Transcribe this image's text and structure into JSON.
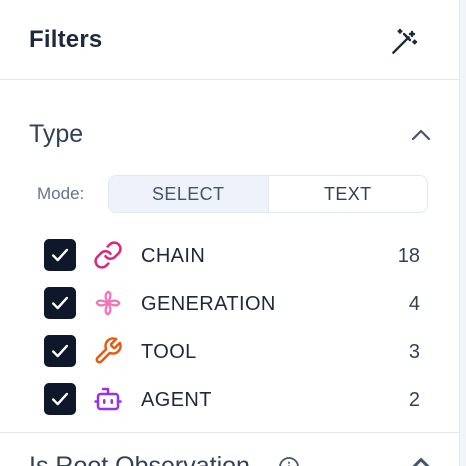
{
  "header": {
    "title": "Filters",
    "wand_icon": "magic-wand-icon"
  },
  "type_section": {
    "title": "Type",
    "collapse_icon": "chevron-up-icon",
    "mode": {
      "label": "Mode:",
      "options": [
        "SELECT",
        "TEXT"
      ],
      "selected": "SELECT"
    },
    "items": [
      {
        "label": "CHAIN",
        "count": "18",
        "checked": true,
        "icon": "link-icon",
        "color": "#db2777"
      },
      {
        "label": "GENERATION",
        "count": "4",
        "checked": true,
        "icon": "sparkle-icon",
        "color": "#f472b6"
      },
      {
        "label": "TOOL",
        "count": "3",
        "checked": true,
        "icon": "wrench-icon",
        "color": "#ea580c"
      },
      {
        "label": "AGENT",
        "count": "2",
        "checked": true,
        "icon": "bot-icon",
        "color": "#9333ea"
      }
    ]
  },
  "next_section": {
    "title": "Is Root Observation",
    "info_icon": "info-icon",
    "chevron_icon": "chevron-icon"
  },
  "colors": {
    "checkbox": "#0f172a",
    "mode_active_bg": "#eef2fa",
    "border": "#e2e8f0"
  }
}
